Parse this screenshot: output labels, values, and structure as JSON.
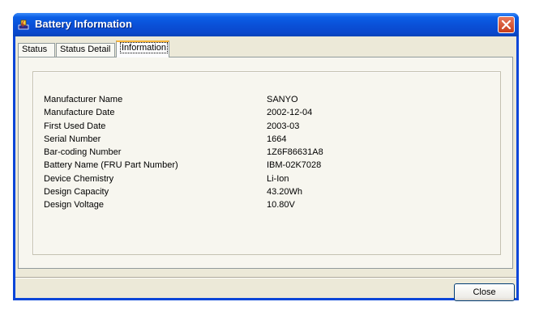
{
  "window": {
    "title": "Battery Information"
  },
  "tabs": [
    {
      "label": "Status",
      "selected": false
    },
    {
      "label": "Status Detail",
      "selected": false
    },
    {
      "label": "Information",
      "selected": true
    }
  ],
  "information": {
    "rows": [
      {
        "label": "Manufacturer Name",
        "value": "SANYO"
      },
      {
        "label": "Manufacture Date",
        "value": "2002-12-04"
      },
      {
        "label": "First Used Date",
        "value": "2003-03"
      },
      {
        "label": "Serial Number",
        "value": "1664"
      },
      {
        "label": "Bar-coding Number",
        "value": "1Z6F86631A8"
      },
      {
        "label": "Battery Name (FRU Part Number)",
        "value": "IBM-02K7028"
      },
      {
        "label": "Device Chemistry",
        "value": "Li-Ion"
      },
      {
        "label": "Design Capacity",
        "value": "43.20Wh"
      },
      {
        "label": "Design Voltage",
        "value": "10.80V"
      }
    ]
  },
  "buttons": {
    "close_label": "Close"
  },
  "colors": {
    "titlebar": "#0a4fd6",
    "close_button": "#c63e1c",
    "dialog_background": "#ece9d8",
    "selected_tab_accent": "#f7b53b"
  },
  "icons": {
    "title": "battery-app-icon",
    "close": "close-icon"
  }
}
